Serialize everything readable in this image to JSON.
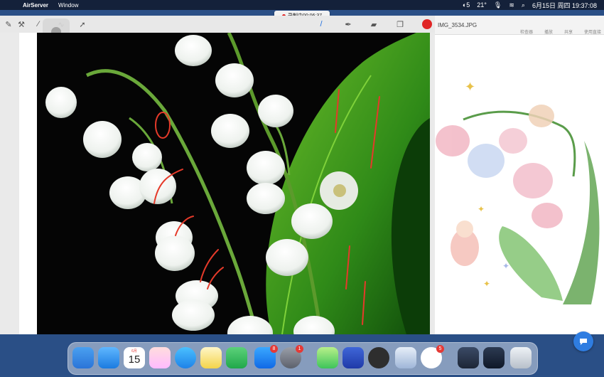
{
  "menubar": {
    "app_name": "AirServer",
    "menu_window": "Window",
    "battery_label": "5",
    "temperature": "21°",
    "datetime": "6月15日 周四  19:37:08"
  },
  "recording": {
    "label": "录制中00:06:37"
  },
  "markup": {
    "tools": [
      "wrench-icon",
      "pen-icon",
      "lasso-icon",
      "arrow-icon",
      "pencil-icon",
      "marker-icon",
      "eraser-icon",
      "layers-icon"
    ],
    "active_color": "#e02525"
  },
  "preview": {
    "filename": "IMG_3534.JPG",
    "tools": [
      "检查器",
      "播放",
      "共享",
      "使用直接"
    ]
  },
  "dock": {
    "apps": [
      "Finder",
      "Mail",
      "Calendar",
      "Launchpad",
      "Safari",
      "Notes",
      "Numbers",
      "App Store",
      "System Settings",
      "Leaf",
      "Layers",
      "AirServer",
      "Preview",
      "Screenium",
      "Gallery",
      "Screen",
      "Trash"
    ],
    "calendar_month": "6月",
    "calendar_day": "15",
    "badges": {
      "app_store": "8",
      "settings": "1",
      "screenium": "5"
    }
  }
}
